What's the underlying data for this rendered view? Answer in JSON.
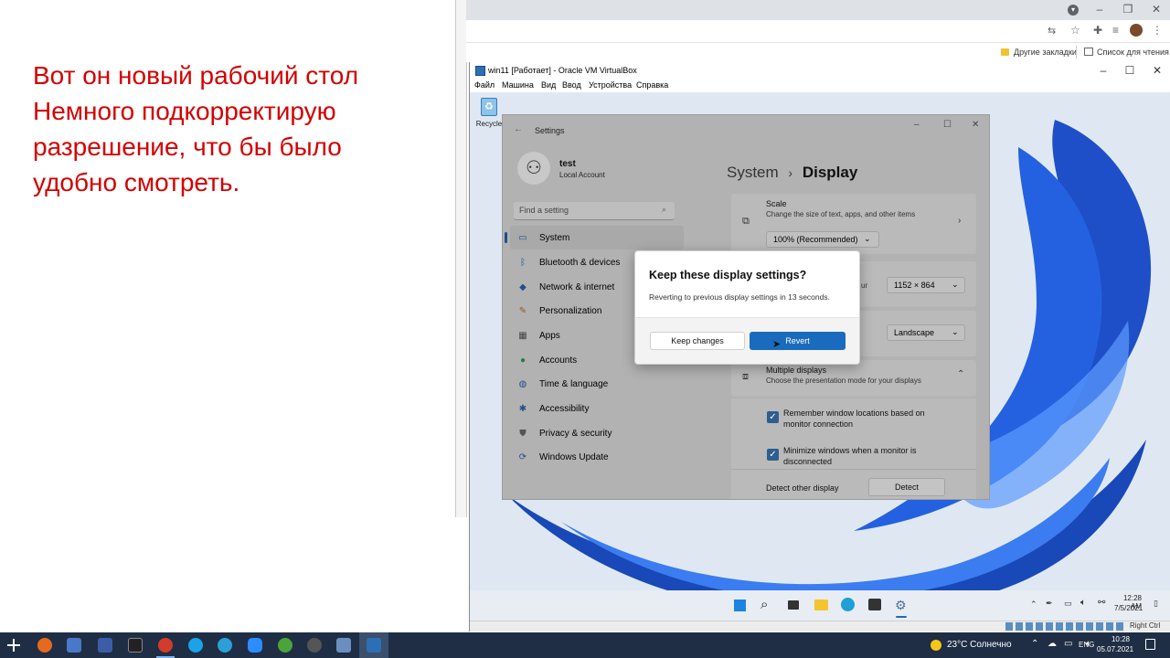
{
  "annotation": {
    "lines": [
      "Вот он новый рабочий стол",
      "Немного подкорректирую",
      "разрешение, что бы было",
      "удобно смотреть."
    ]
  },
  "browser": {
    "bookmark_other": "Другие закладки",
    "reading_list": "Список для чтения"
  },
  "virtualbox": {
    "title": "win11 [Работает] - Oracle VM VirtualBox",
    "menu": [
      "Файл",
      "Машина",
      "Вид",
      "Ввод",
      "Устройства",
      "Справка"
    ],
    "status_right": "Right Ctrl"
  },
  "vm_desktop": {
    "recycle_bin_label": "Recycle"
  },
  "settings": {
    "title": "Settings",
    "user_name": "test",
    "user_type": "Local Account",
    "search_placeholder": "Find a setting",
    "nav": [
      {
        "label": "System",
        "icon": "monitor-icon"
      },
      {
        "label": "Bluetooth & devices",
        "icon": "bluetooth-icon"
      },
      {
        "label": "Network & internet",
        "icon": "wifi-icon"
      },
      {
        "label": "Personalization",
        "icon": "brush-icon"
      },
      {
        "label": "Apps",
        "icon": "apps-icon"
      },
      {
        "label": "Accounts",
        "icon": "person-icon"
      },
      {
        "label": "Time & language",
        "icon": "globe-icon"
      },
      {
        "label": "Accessibility",
        "icon": "accessibility-icon"
      },
      {
        "label": "Privacy & security",
        "icon": "shield-icon"
      },
      {
        "label": "Windows Update",
        "icon": "update-icon"
      }
    ],
    "breadcrumb_parent": "System",
    "breadcrumb_sep": "›",
    "breadcrumb_current": "Display",
    "scale_title": "Scale",
    "scale_desc": "Change the size of text, apps, and other items",
    "scale_value": "100% (Recommended)",
    "resolution_partial": "ur",
    "resolution_value": "1152 × 864",
    "orientation_value": "Landscape",
    "multiple_title": "Multiple displays",
    "multiple_desc": "Choose the presentation mode for your displays",
    "remember_label": "Remember window locations based on monitor connection",
    "minimize_label": "Minimize windows when a monitor is disconnected",
    "detect_label": "Detect other display",
    "detect_button": "Detect"
  },
  "dialog": {
    "title": "Keep these display settings?",
    "message": "Reverting to previous display settings in 13 seconds.",
    "keep_label": "Keep changes",
    "revert_label": "Revert"
  },
  "vm_taskbar": {
    "time": "12:28 AM",
    "date": "7/5/2021"
  },
  "host_taskbar": {
    "weather": "23°C Солнечно",
    "lang": "ENG",
    "time": "10:28",
    "date": "05.07.2021"
  },
  "colors": {
    "annotation": "#d40000",
    "accent": "#1a6bbd",
    "host_taskbar": "#1f2e45"
  }
}
